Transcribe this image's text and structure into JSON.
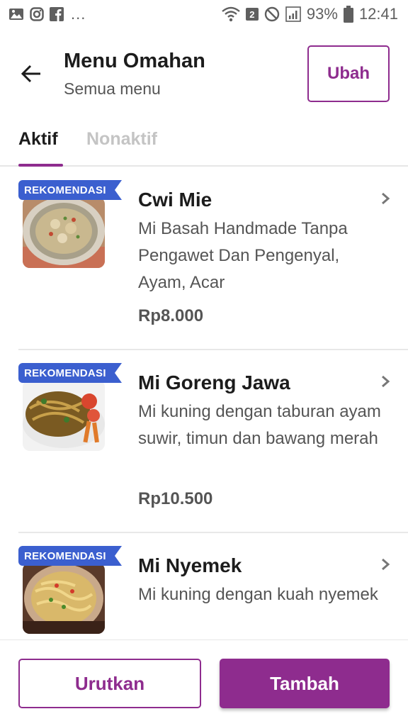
{
  "status_bar": {
    "left_icons": [
      "image-icon",
      "instagram-icon",
      "facebook-icon"
    ],
    "more": "...",
    "notification_count": "2",
    "battery_percent": "93%",
    "time": "12:41"
  },
  "header": {
    "title": "Menu Omahan",
    "subtitle": "Semua menu",
    "edit_label": "Ubah"
  },
  "tabs": [
    {
      "label": "Aktif",
      "active": true
    },
    {
      "label": "Nonaktif",
      "active": false
    }
  ],
  "menu_items": [
    {
      "badge": "REKOMENDASI",
      "name": "Cwi Mie",
      "description": "Mi Basah Handmade Tanpa Pengawet Dan Pengenyal, Ayam, Acar",
      "price": "Rp8.000"
    },
    {
      "badge": "REKOMENDASI",
      "name": "Mi Goreng Jawa",
      "description": "Mi kuning dengan taburan ayam suwir, timun dan bawang merah",
      "price": "Rp10.500"
    },
    {
      "badge": "REKOMENDASI",
      "name": "Mi Nyemek",
      "description": "Mi kuning dengan kuah nyemek",
      "price": ""
    }
  ],
  "bottom_bar": {
    "sort_label": "Urutkan",
    "add_label": "Tambah"
  },
  "colors": {
    "accent": "#8e2c8e",
    "badge_blue": "#3b5fcf",
    "text_primary": "#1c1c1c",
    "text_secondary": "#555555"
  }
}
